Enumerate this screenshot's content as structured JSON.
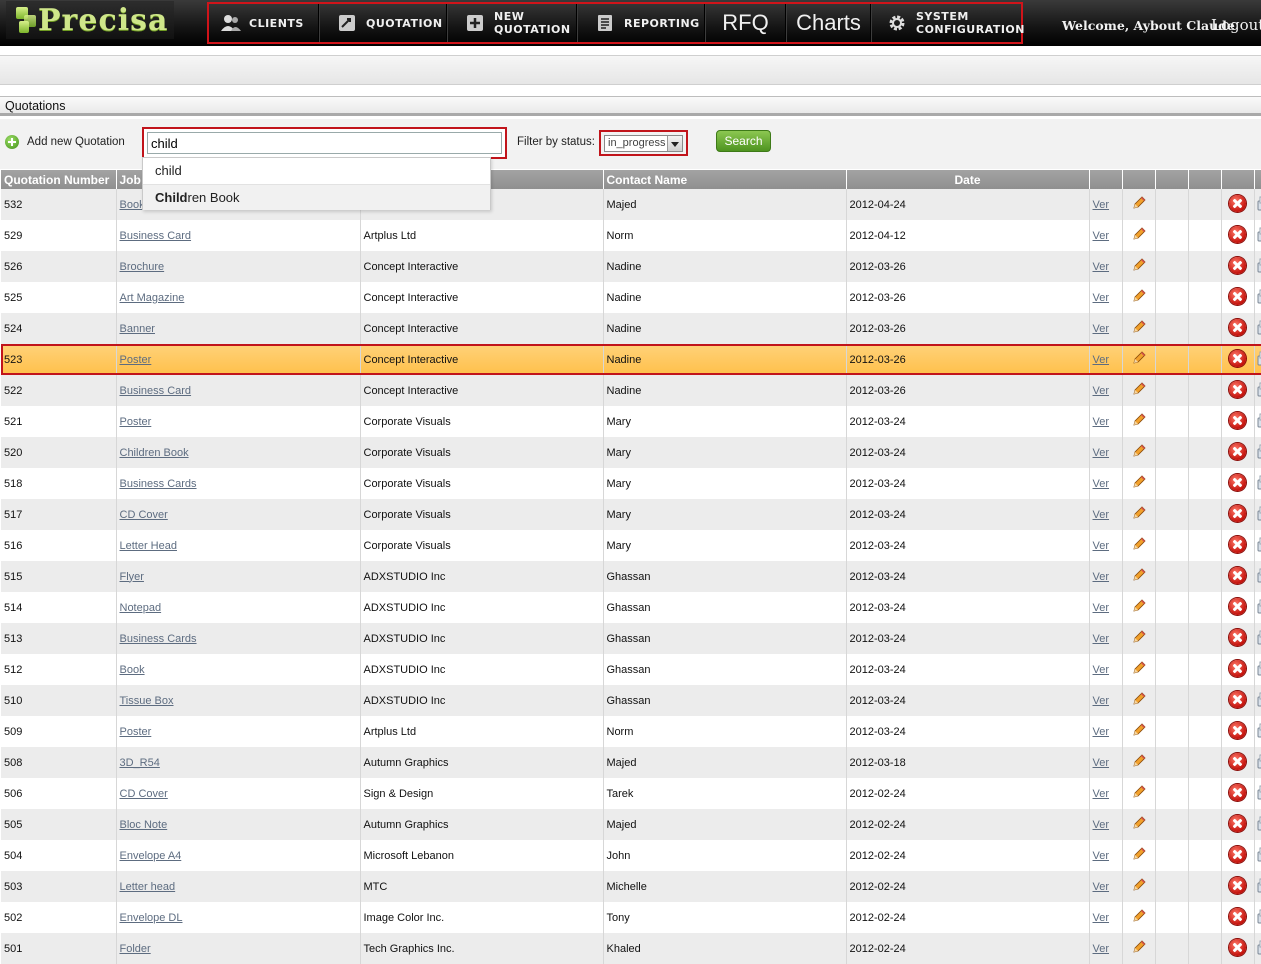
{
  "app": {
    "logo_text": "Precisa",
    "welcome": "Welcome, Aybout Claude",
    "logout": "Logout"
  },
  "nav": {
    "clients": "CLIENTS",
    "quotation": "QUOTATION",
    "new_quotation_1": "NEW",
    "new_quotation_2": "QUOTATION",
    "reporting": "REPORTING",
    "rfq": "RFQ",
    "charts": "Charts",
    "system_config_1": "SYSTEM",
    "system_config_2": "CONFIGURATION"
  },
  "panel": {
    "title": "Quotations"
  },
  "toolbar": {
    "add_new": "Add new Quotation",
    "search_value": "child",
    "filter_label": "Filter by status:",
    "filter_value": "in_progress",
    "search_button": "Search"
  },
  "autocomplete": {
    "item1": "child",
    "item2_match": "Child",
    "item2_rest": "ren Book"
  },
  "table": {
    "headers": {
      "number": "Quotation Number",
      "job": "Job",
      "client": "",
      "contact": "Contact Name",
      "date": "Date"
    },
    "ver_label": "Ver",
    "highlighted_row": 5,
    "rows": [
      {
        "num": "532",
        "job": "Book",
        "client": "",
        "contact": "Majed",
        "date": "2012-04-24"
      },
      {
        "num": "529",
        "job": "Business Card",
        "client": "Artplus Ltd",
        "contact": "Norm",
        "date": "2012-04-12"
      },
      {
        "num": "526",
        "job": "Brochure",
        "client": "Concept Interactive",
        "contact": "Nadine",
        "date": "2012-03-26"
      },
      {
        "num": "525",
        "job": "Art Magazine",
        "client": "Concept Interactive",
        "contact": "Nadine",
        "date": "2012-03-26"
      },
      {
        "num": "524",
        "job": "Banner",
        "client": "Concept Interactive",
        "contact": "Nadine",
        "date": "2012-03-26"
      },
      {
        "num": "523",
        "job": "Poster",
        "client": "Concept Interactive",
        "contact": "Nadine",
        "date": "2012-03-26"
      },
      {
        "num": "522",
        "job": "Business Card",
        "client": "Concept Interactive",
        "contact": "Nadine",
        "date": "2012-03-26"
      },
      {
        "num": "521",
        "job": "Poster",
        "client": "Corporate Visuals",
        "contact": "Mary",
        "date": "2012-03-24"
      },
      {
        "num": "520",
        "job": "Children Book",
        "client": "Corporate Visuals",
        "contact": "Mary",
        "date": "2012-03-24"
      },
      {
        "num": "518",
        "job": "Business Cards",
        "client": "Corporate Visuals",
        "contact": "Mary",
        "date": "2012-03-24"
      },
      {
        "num": "517",
        "job": "CD Cover",
        "client": "Corporate Visuals",
        "contact": "Mary",
        "date": "2012-03-24"
      },
      {
        "num": "516",
        "job": "Letter Head",
        "client": "Corporate Visuals",
        "contact": "Mary",
        "date": "2012-03-24"
      },
      {
        "num": "515",
        "job": "Flyer",
        "client": "ADXSTUDIO Inc",
        "contact": "Ghassan",
        "date": "2012-03-24"
      },
      {
        "num": "514",
        "job": "Notepad",
        "client": "ADXSTUDIO Inc",
        "contact": "Ghassan",
        "date": "2012-03-24"
      },
      {
        "num": "513",
        "job": "Business Cards",
        "client": "ADXSTUDIO Inc",
        "contact": "Ghassan",
        "date": "2012-03-24"
      },
      {
        "num": "512",
        "job": "Book",
        "client": "ADXSTUDIO Inc",
        "contact": "Ghassan",
        "date": "2012-03-24"
      },
      {
        "num": "510",
        "job": "Tissue Box",
        "client": "ADXSTUDIO Inc",
        "contact": "Ghassan",
        "date": "2012-03-24"
      },
      {
        "num": "509",
        "job": "Poster",
        "client": "Artplus Ltd",
        "contact": "Norm",
        "date": "2012-03-24"
      },
      {
        "num": "508",
        "job": "3D_R54",
        "client": "Autumn Graphics",
        "contact": "Majed",
        "date": "2012-03-18"
      },
      {
        "num": "506",
        "job": "CD Cover",
        "client": "Sign & Design",
        "contact": "Tarek",
        "date": "2012-02-24"
      },
      {
        "num": "505",
        "job": "Bloc Note",
        "client": "Autumn Graphics",
        "contact": "Majed",
        "date": "2012-02-24"
      },
      {
        "num": "504",
        "job": "Envelope A4",
        "client": "Microsoft Lebanon",
        "contact": "John",
        "date": "2012-02-24"
      },
      {
        "num": "503",
        "job": "Letter head",
        "client": "MTC",
        "contact": "Michelle",
        "date": "2012-02-24"
      },
      {
        "num": "502",
        "job": "Envelope DL",
        "client": "Image Color Inc.",
        "contact": "Tony",
        "date": "2012-02-24"
      },
      {
        "num": "501",
        "job": "Folder",
        "client": "Tech Graphics Inc.",
        "contact": "Khaled",
        "date": "2012-02-24"
      }
    ]
  }
}
